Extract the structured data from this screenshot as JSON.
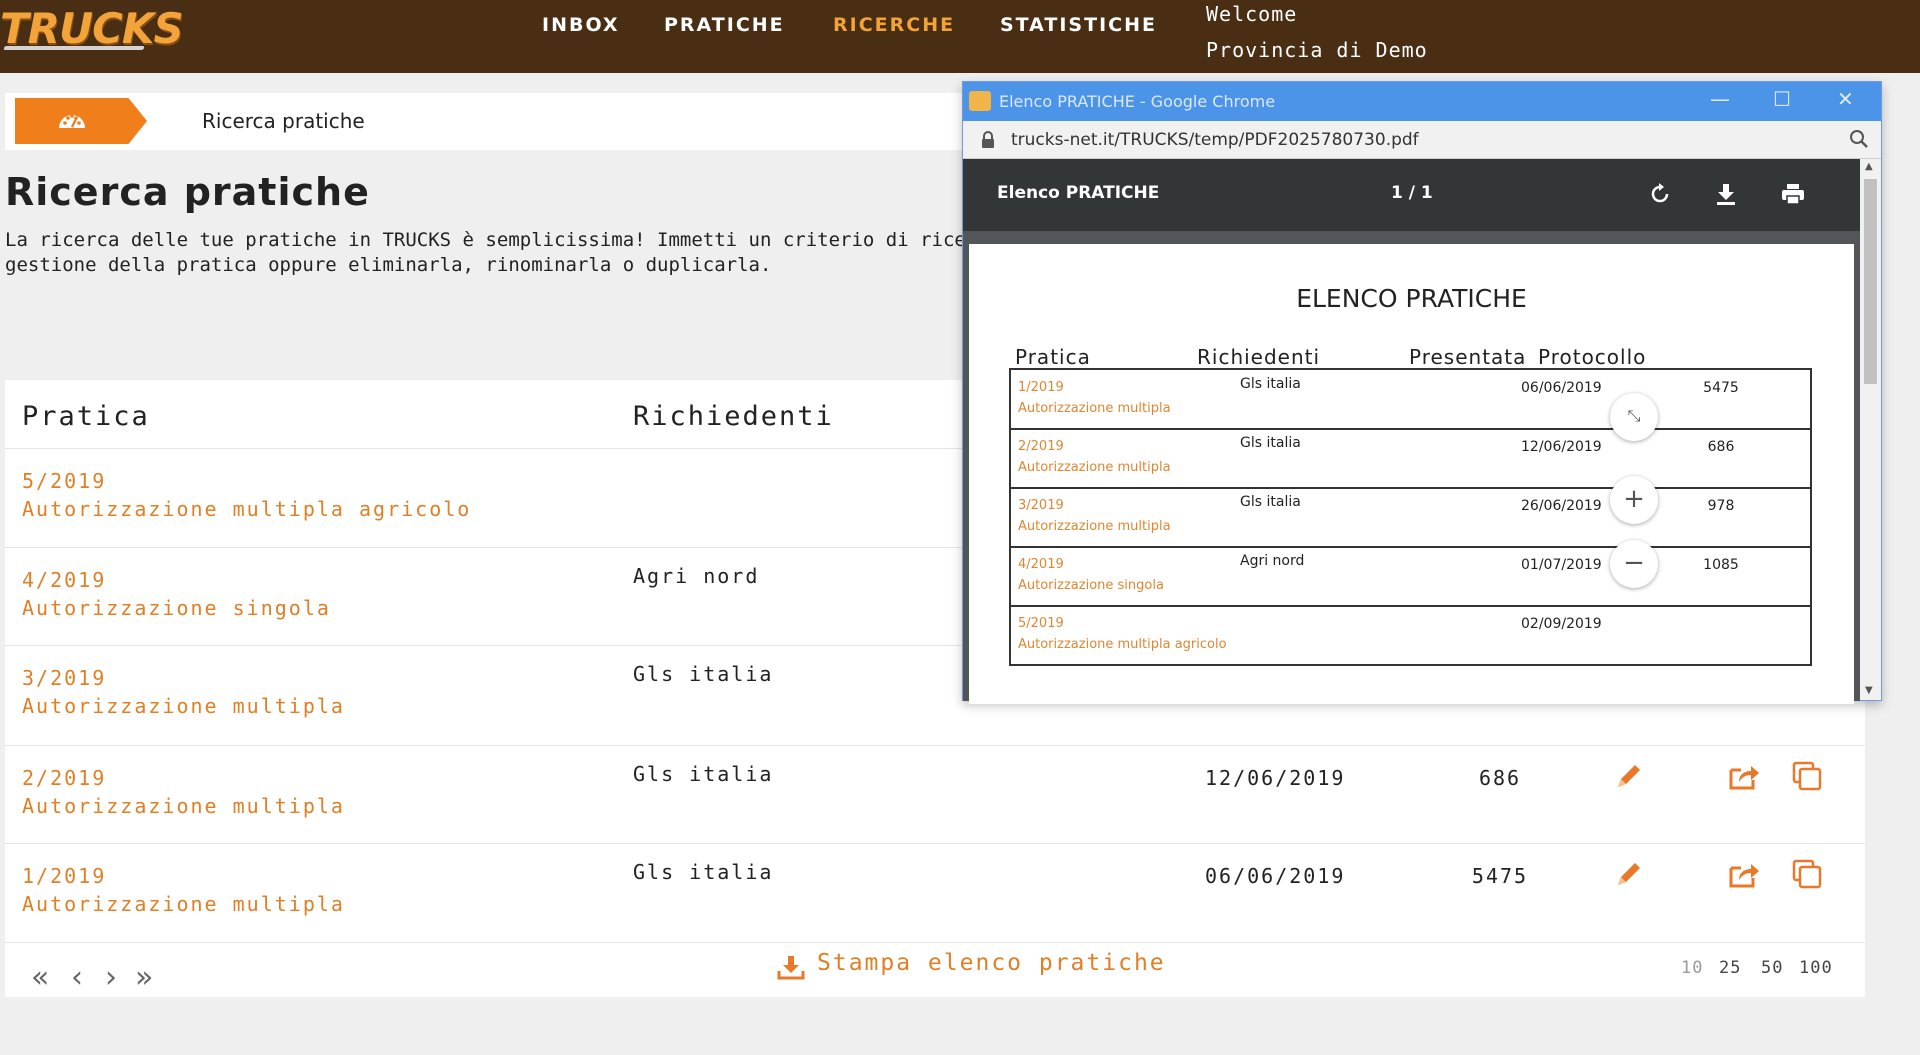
{
  "app": {
    "logo": "TRUCKS",
    "nav": [
      "INBOX",
      "PRATICHE",
      "RICERCHE",
      "STATISTICHE"
    ],
    "active_nav": "RICERCHE",
    "welcome_line1": "Welcome",
    "welcome_line2": "Provincia di Demo"
  },
  "breadcrumb": {
    "icon": "dashboard-icon",
    "label": "Ricerca pratiche"
  },
  "page": {
    "title": "Ricerca pratiche",
    "intro_line1": "La ricerca delle tue pratiche in TRUCKS è semplicissima! Immetti un criterio di ricerca",
    "intro_line2": "gestione della pratica oppure eliminarla, rinominarla o duplicarla."
  },
  "table": {
    "headers": {
      "pratica": "Pratica",
      "richiedenti": "Richiedenti"
    },
    "rows": [
      {
        "numero": "5/2019",
        "tipo": "Autorizzazione multipla agricolo",
        "richiedente": "",
        "data": "",
        "protocollo": ""
      },
      {
        "numero": "4/2019",
        "tipo": "Autorizzazione singola",
        "richiedente": "Agri nord",
        "data": "",
        "protocollo": ""
      },
      {
        "numero": "3/2019",
        "tipo": "Autorizzazione multipla",
        "richiedente": "Gls italia",
        "data": "",
        "protocollo": ""
      },
      {
        "numero": "2/2019",
        "tipo": "Autorizzazione multipla",
        "richiedente": "Gls italia",
        "data": "12/06/2019",
        "protocollo": "686"
      },
      {
        "numero": "1/2019",
        "tipo": "Autorizzazione multipla",
        "richiedente": "Gls italia",
        "data": "06/06/2019",
        "protocollo": "5475"
      }
    ],
    "pager": {
      "first": "«",
      "prev": "‹",
      "next": "›",
      "last": "»"
    },
    "print_label": "Stampa elenco pratiche",
    "page_sizes": [
      "10",
      "25",
      "50",
      "100"
    ],
    "accent_color": "#e07f25"
  },
  "popup": {
    "window_title": "Elenco PRATICHE - Google Chrome",
    "url": "trucks-net.it/TRUCKS/temp/PDF2025780730.pdf",
    "doc_title": "Elenco PRATICHE",
    "page_indicator": "1 / 1",
    "pdf": {
      "heading": "ELENCO PRATICHE",
      "headers": [
        "Pratica",
        "Richiedenti",
        "Presentata",
        "Protocollo"
      ],
      "rows": [
        {
          "numero": "1/2019",
          "tipo": "Autorizzazione multipla",
          "richiedente": "Gls italia",
          "data": "06/06/2019",
          "protocollo": "5475"
        },
        {
          "numero": "2/2019",
          "tipo": "Autorizzazione multipla",
          "richiedente": "Gls italia",
          "data": "12/06/2019",
          "protocollo": "686"
        },
        {
          "numero": "3/2019",
          "tipo": "Autorizzazione multipla",
          "richiedente": "Gls italia",
          "data": "26/06/2019",
          "protocollo": "978"
        },
        {
          "numero": "4/2019",
          "tipo": "Autorizzazione singola",
          "richiedente": "Agri nord",
          "data": "01/07/2019",
          "protocollo": "1085"
        },
        {
          "numero": "5/2019",
          "tipo": "Autorizzazione multipla agricolo",
          "richiedente": "",
          "data": "02/09/2019",
          "protocollo": ""
        }
      ]
    },
    "chrome_blue": "#4c94e8"
  }
}
